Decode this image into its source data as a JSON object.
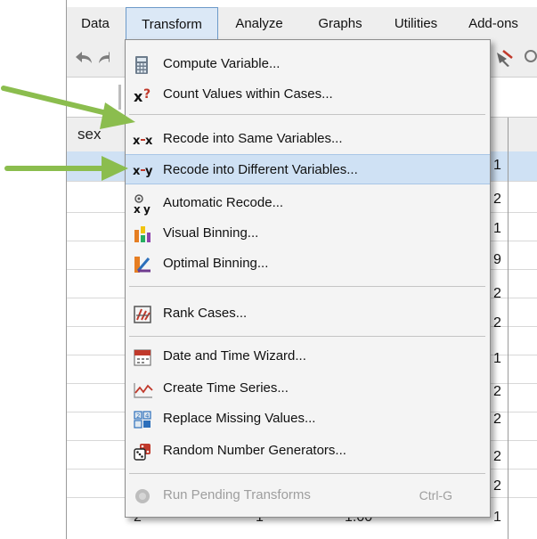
{
  "menubar": {
    "items": [
      {
        "label": "Data"
      },
      {
        "label": "Transform"
      },
      {
        "label": "Analyze"
      },
      {
        "label": "Graphs"
      },
      {
        "label": "Utilities"
      },
      {
        "label": "Add-ons"
      }
    ],
    "active": "Transform"
  },
  "grid": {
    "column_header": "sex",
    "cell_values": [
      "1",
      "2",
      "1",
      "9",
      "2",
      "2",
      "1",
      "2",
      "2",
      "2",
      "2",
      "2"
    ],
    "bottom_row": [
      "2",
      "1",
      "1.00",
      "1"
    ]
  },
  "transform_menu": {
    "items": [
      {
        "label": "Compute Variable...",
        "icon": "calculator-icon"
      },
      {
        "label": "Count Values within Cases...",
        "icon": "count-x-icon"
      },
      {
        "label": "Recode into Same Variables...",
        "icon": "recode-same-icon"
      },
      {
        "label": "Recode into Different Variables...",
        "icon": "recode-different-icon",
        "highlighted": true
      },
      {
        "label": "Automatic Recode...",
        "icon": "automatic-recode-icon"
      },
      {
        "label": "Visual Binning...",
        "icon": "visual-binning-icon"
      },
      {
        "label": "Optimal Binning...",
        "icon": "optimal-binning-icon"
      },
      {
        "label": "Rank Cases...",
        "icon": "rank-cases-icon"
      },
      {
        "label": "Date and Time Wizard...",
        "icon": "calendar-icon"
      },
      {
        "label": "Create Time Series...",
        "icon": "time-series-icon"
      },
      {
        "label": "Replace Missing Values...",
        "icon": "replace-missing-icon"
      },
      {
        "label": "Random Number Generators...",
        "icon": "random-number-icon"
      },
      {
        "label": "Run Pending Transforms",
        "icon": "run-pending-icon",
        "disabled": true,
        "shortcut": "Ctrl-G"
      }
    ]
  },
  "colors": {
    "menu_highlight": "#cfe1f4",
    "arrow": "#8bbd4e",
    "menubar_bg": "#eeeeee"
  }
}
